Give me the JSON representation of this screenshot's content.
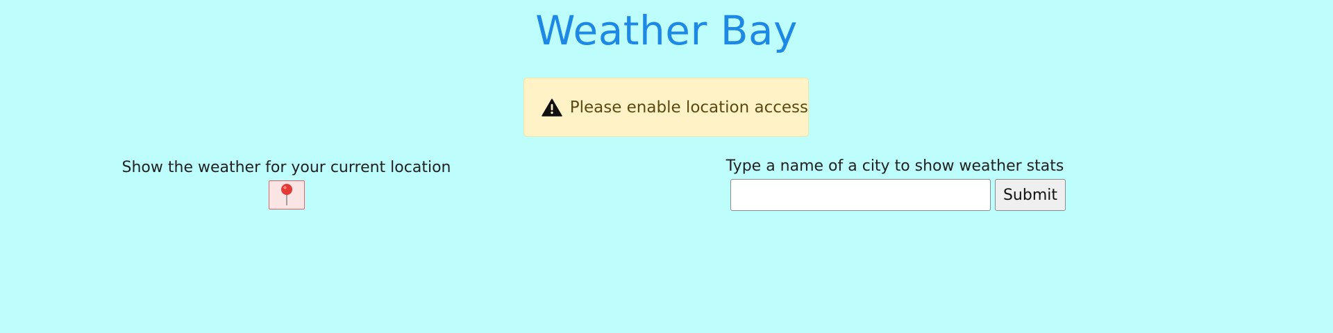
{
  "header": {
    "title": "Weather Bay"
  },
  "alert": {
    "icon": "warning-triangle-icon",
    "message": "Please enable location access",
    "colors": {
      "background": "#fff2c7",
      "text": "#5a4a12"
    }
  },
  "location": {
    "label": "Show the weather for your current location",
    "button_icon": "map-pin-icon"
  },
  "search": {
    "label": "Type a name of a city to show weather stats",
    "value": "",
    "placeholder": "",
    "submit_label": "Submit"
  },
  "colors": {
    "page_background": "#bdfefc",
    "title": "#1e88e5",
    "pin_red": "#e53935"
  }
}
